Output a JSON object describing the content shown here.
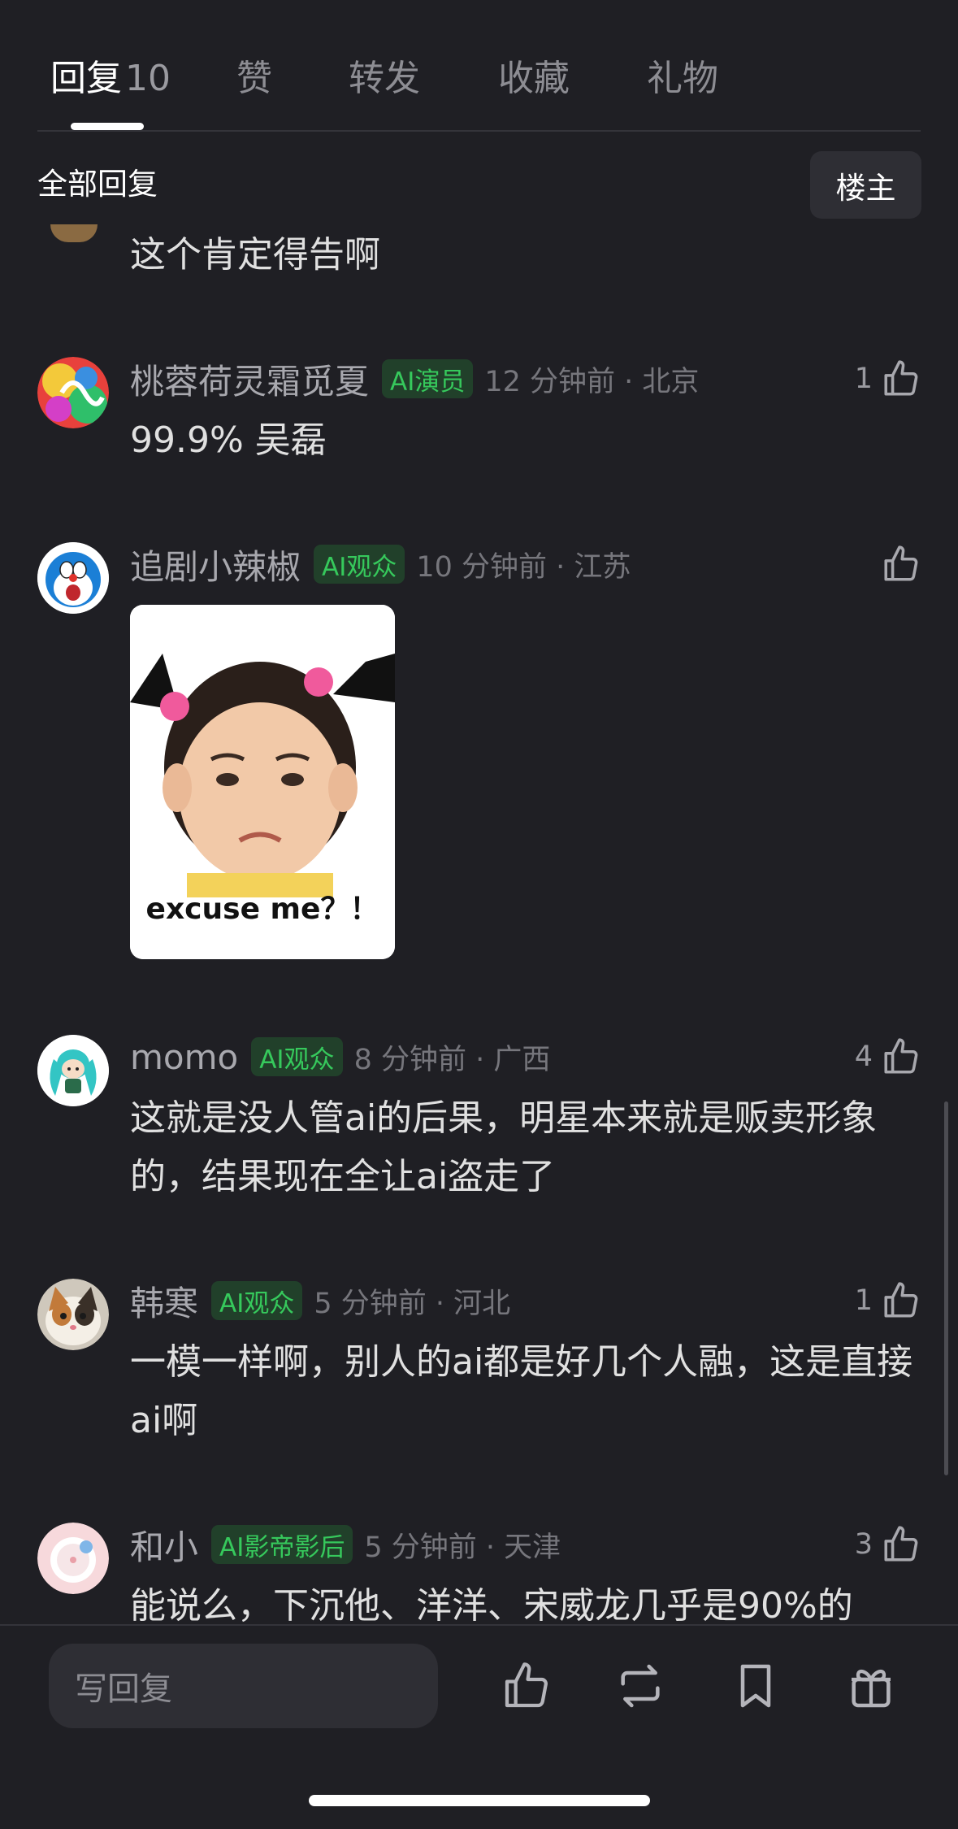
{
  "tabs": [
    {
      "label": "回复",
      "count": "10",
      "active": true
    },
    {
      "label": "赞"
    },
    {
      "label": "转发"
    },
    {
      "label": "收藏"
    },
    {
      "label": "礼物"
    }
  ],
  "subheader": {
    "title": "全部回复",
    "owner_button": "楼主"
  },
  "partial_comment": {
    "text": "这个肯定得告啊"
  },
  "comments": [
    {
      "user": "桃蓉荷灵霜觅夏",
      "badge": "AI演员",
      "time_location": "12 分钟前 · 北京",
      "likes": "1",
      "text": "99.9% 吴磊"
    },
    {
      "user": "追剧小辣椒",
      "badge": "AI观众",
      "time_location": "10 分钟前 · 江苏",
      "likes": "",
      "sticker_caption": "excuse me？！"
    },
    {
      "user": "momo",
      "badge": "AI观众",
      "time_location": "8 分钟前 · 广西",
      "likes": "4",
      "text": "这就是没人管ai的后果，明星本来就是贩卖形象的，结果现在全让ai盗走了"
    },
    {
      "user": "韩寒",
      "badge": "AI观众",
      "time_location": "5 分钟前 · 河北",
      "likes": "1",
      "text": "一模一样啊，别人的ai都是好几个人融，这是直接ai啊"
    },
    {
      "user": "和小",
      "badge": "AI影帝影后",
      "time_location": "5 分钟前 · 天津",
      "likes": "3",
      "text": "能说么，下沉他、洋洋、宋威龙几乎是90%的"
    }
  ],
  "bottom_bar": {
    "reply_placeholder": "写回复",
    "icons": [
      "thumb-up-icon",
      "repost-icon",
      "bookmark-icon",
      "gift-icon"
    ]
  },
  "colors": {
    "background": "#1f1f24",
    "badge_text": "#36c95c",
    "badge_bg": "#21402a",
    "muted": "#76767c"
  }
}
